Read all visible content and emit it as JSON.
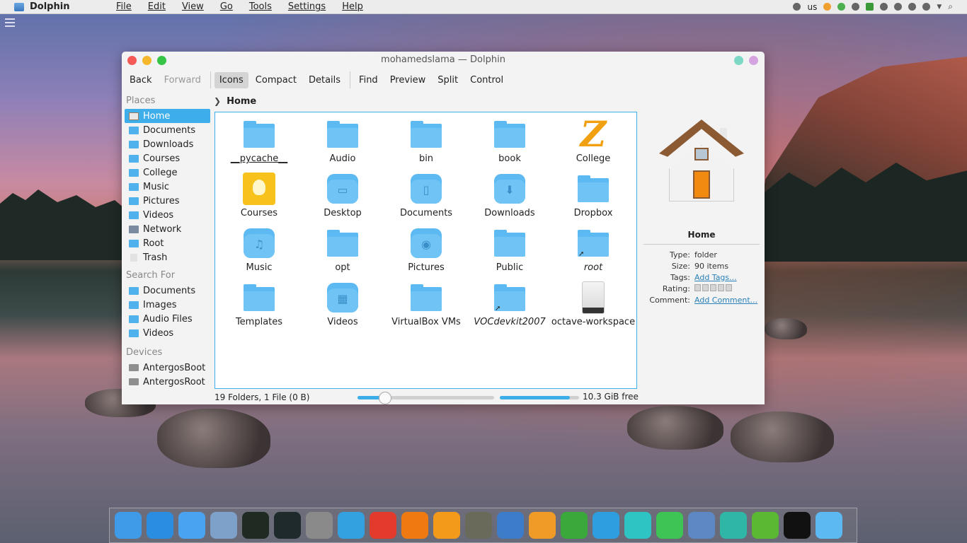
{
  "topbar": {
    "app_name": "Dolphin",
    "menu": [
      "File",
      "Edit",
      "View",
      "Go",
      "Tools",
      "Settings",
      "Help"
    ],
    "keyboard_layout": "us"
  },
  "window": {
    "title": "mohamedslama — Dolphin"
  },
  "toolbar": {
    "back": "Back",
    "forward": "Forward",
    "icons": "Icons",
    "compact": "Compact",
    "details": "Details",
    "find": "Find",
    "preview": "Preview",
    "split": "Split",
    "control": "Control"
  },
  "sidebar": {
    "places_title": "Places",
    "places": [
      {
        "label": "Home",
        "icon": "home-icon"
      },
      {
        "label": "Documents",
        "icon": "folder-icon"
      },
      {
        "label": "Downloads",
        "icon": "folder-icon"
      },
      {
        "label": "Courses",
        "icon": "folder-icon"
      },
      {
        "label": "College",
        "icon": "folder-icon"
      },
      {
        "label": "Music",
        "icon": "folder-icon"
      },
      {
        "label": "Pictures",
        "icon": "folder-icon"
      },
      {
        "label": "Videos",
        "icon": "folder-icon"
      },
      {
        "label": "Network",
        "icon": "network-icon"
      },
      {
        "label": "Root",
        "icon": "folder-icon"
      },
      {
        "label": "Trash",
        "icon": "trash-icon"
      }
    ],
    "search_title": "Search For",
    "search": [
      {
        "label": "Documents"
      },
      {
        "label": "Images"
      },
      {
        "label": "Audio Files"
      },
      {
        "label": "Videos"
      }
    ],
    "devices_title": "Devices",
    "devices": [
      {
        "label": "AntergosBoot"
      },
      {
        "label": "AntergosRoot"
      }
    ]
  },
  "breadcrumb": {
    "current": "Home"
  },
  "files": [
    {
      "name": "__pycache__",
      "icon": "folder-icon"
    },
    {
      "name": "Audio",
      "icon": "folder-icon"
    },
    {
      "name": "bin",
      "icon": "folder-icon"
    },
    {
      "name": "book",
      "icon": "folder-icon"
    },
    {
      "name": "College",
      "icon": "z-app-icon"
    },
    {
      "name": "Courses",
      "icon": "lightbulb-icon"
    },
    {
      "name": "Desktop",
      "icon": "desktop-folder-icon"
    },
    {
      "name": "Documents",
      "icon": "documents-folder-icon"
    },
    {
      "name": "Downloads",
      "icon": "downloads-folder-icon"
    },
    {
      "name": "Dropbox",
      "icon": "folder-icon"
    },
    {
      "name": "Music",
      "icon": "music-folder-icon"
    },
    {
      "name": "opt",
      "icon": "folder-icon"
    },
    {
      "name": "Pictures",
      "icon": "pictures-folder-icon"
    },
    {
      "name": "Public",
      "icon": "folder-icon"
    },
    {
      "name": "root",
      "icon": "folder-link-icon"
    },
    {
      "name": "Templates",
      "icon": "folder-icon"
    },
    {
      "name": "Videos",
      "icon": "videos-folder-icon"
    },
    {
      "name": "VirtualBox VMs",
      "icon": "folder-icon"
    },
    {
      "name": "VOCdevkit2007",
      "icon": "folder-link-icon"
    },
    {
      "name": "octave-workspace",
      "icon": "drive-file-icon"
    }
  ],
  "status": {
    "summary": "19 Folders, 1 File (0 B)",
    "free_space": "10.3 GiB free",
    "zoom_fraction": 0.2,
    "used_fraction": 0.88
  },
  "info_panel": {
    "name": "Home",
    "type_label": "Type:",
    "type_value": "folder",
    "size_label": "Size:",
    "size_value": "90 items",
    "tags_label": "Tags:",
    "tags_value": "Add Tags...",
    "rating_label": "Rating:",
    "comment_label": "Comment:",
    "comment_value": "Add Comment..."
  },
  "colors": {
    "accent": "#3daee9",
    "folder": "#5cb9f2"
  },
  "dock": [
    {
      "name": "finder-icon",
      "color": "#3f9ae8"
    },
    {
      "name": "safari-icon",
      "color": "#2a8de0"
    },
    {
      "name": "keynote-icon",
      "color": "#4aa3f0"
    },
    {
      "name": "xcode-icon",
      "color": "#7ea1c9"
    },
    {
      "name": "pycharm-icon",
      "color": "#1e2a22"
    },
    {
      "name": "clion-icon",
      "color": "#1e2a2c"
    },
    {
      "name": "system-preferences-icon",
      "color": "#8a8a8a"
    },
    {
      "name": "cube-icon",
      "color": "#33a0e0"
    },
    {
      "name": "youtube-icon",
      "color": "#e33a2e"
    },
    {
      "name": "vlc-icon",
      "color": "#f07a12"
    },
    {
      "name": "orange-icon",
      "color": "#f39a1a"
    },
    {
      "name": "gimp-icon",
      "color": "#6a6a5a"
    },
    {
      "name": "text-editor-icon",
      "color": "#3d7cc9"
    },
    {
      "name": "calculator-icon",
      "color": "#f09a28"
    },
    {
      "name": "download-manager-icon",
      "color": "#3aa83a"
    },
    {
      "name": "browser-icon",
      "color": "#2f9ee0"
    },
    {
      "name": "remote-desktop-icon",
      "color": "#2fc4c4"
    },
    {
      "name": "facetime-icon",
      "color": "#3ec454"
    },
    {
      "name": "photo-icon",
      "color": "#5d88c4"
    },
    {
      "name": "search-app-icon",
      "color": "#2fb6a6"
    },
    {
      "name": "battery-app-icon",
      "color": "#5ab832"
    },
    {
      "name": "clock-icon",
      "color": "#111111"
    },
    {
      "name": "folder-app-icon",
      "color": "#5cb9f2"
    }
  ]
}
